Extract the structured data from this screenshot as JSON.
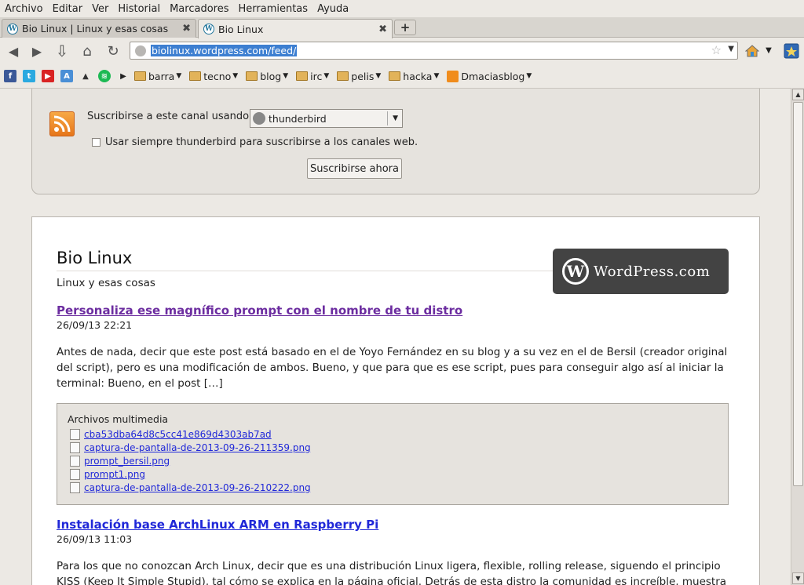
{
  "menu": [
    "Archivo",
    "Editar",
    "Ver",
    "Historial",
    "Marcadores",
    "Herramientas",
    "Ayuda"
  ],
  "tabs": [
    {
      "title": "Bio Linux | Linux y esas cosas"
    },
    {
      "title": "Bio Linux"
    }
  ],
  "tab_close_glyph": "✖",
  "new_tab_glyph": "+",
  "nav": {
    "url": "biolinux.wordpress.com/feed/"
  },
  "bookmarks": {
    "folders": [
      "barra",
      "tecno",
      "blog",
      "irc",
      "pelis",
      "hacka"
    ],
    "feed_label": "Dmaciasblog"
  },
  "subscribe": {
    "label": "Suscribirse a este canal usando",
    "reader": "thunderbird",
    "always_label": "Usar siempre thunderbird para suscribirse a los canales web.",
    "button": "Suscribirse ahora"
  },
  "feed": {
    "title": "Bio Linux",
    "subtitle": "Linux y esas cosas",
    "badge": "WordPress.com",
    "entries": [
      {
        "title": "Personaliza ese magnífico prompt con el nombre de tu distro",
        "date": "26/09/13 22:21",
        "body": "Antes de nada, decir que este post está basado en el de Yoyo Fernández en su blog y a su vez en el de Bersil (creador original del script), pero es una modificación de ambos. Bueno, y que para que es ese script, pues para conseguir algo así al iniciar la terminal: Bueno, en el post […]"
      },
      {
        "title": "Instalación base ArchLinux ARM en Raspberry Pi",
        "date": "26/09/13 11:03",
        "body": "Para los que no conozcan Arch Linux, decir que es una distribución Linux ligera, flexible, rolling release, siguendo el principio KISS (Keep It Simple Stupid), tal cómo se explica en la página oficial. Detrás de esta distro la comunidad es increíble, muestra de ello es la wiki, en esta wiki"
      }
    ],
    "media": {
      "heading": "Archivos multimedia",
      "files": [
        "cba53dba64d8c5cc41e869d4303ab7ad",
        "captura-de-pantalla-de-2013-09-26-211359.png",
        "prompt_bersil.png",
        "prompt1.png",
        "captura-de-pantalla-de-2013-09-26-210222.png"
      ]
    }
  }
}
